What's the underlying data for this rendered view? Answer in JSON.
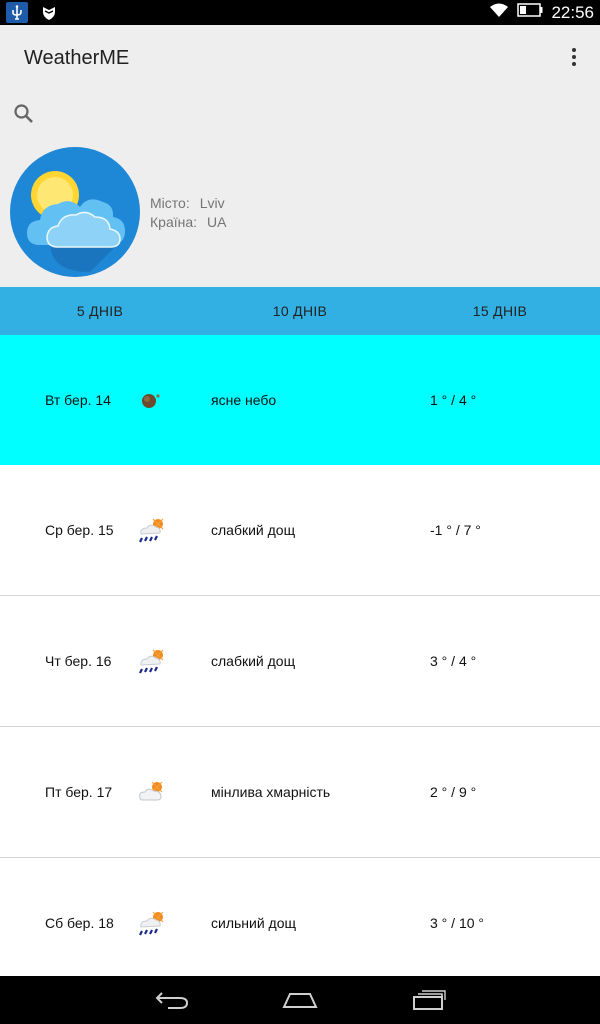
{
  "status_bar": {
    "time": "22:56",
    "icons": [
      "usb-icon",
      "shield-icon",
      "wifi-icon",
      "battery-icon"
    ]
  },
  "app": {
    "title": "WeatherME",
    "menu_icon": "overflow-menu-icon"
  },
  "search": {
    "icon": "search-icon"
  },
  "location": {
    "city_label": "Місто:",
    "city_value": "Lviv",
    "country_label": "Країна:",
    "country_value": "UA"
  },
  "tabs": [
    {
      "label": "5 ДНІВ"
    },
    {
      "label": "10 ДНІВ"
    },
    {
      "label": "15 ДНІВ"
    }
  ],
  "forecast": [
    {
      "date": "Вт бер. 14",
      "description": "ясне небо",
      "temp": "1 ° / 4 °",
      "icon": "clear-night-icon",
      "selected": true
    },
    {
      "date": "Ср бер. 15",
      "description": "слабкий дощ",
      "temp": "-1 ° / 7 °",
      "icon": "rain-sun-icon",
      "selected": false
    },
    {
      "date": "Чт бер. 16",
      "description": "слабкий дощ",
      "temp": "3 ° / 4 °",
      "icon": "rain-sun-icon",
      "selected": false
    },
    {
      "date": "Пт бер. 17",
      "description": "мінлива хмарність",
      "temp": "2 ° / 9 °",
      "icon": "partly-cloudy-icon",
      "selected": false
    },
    {
      "date": "Сб бер. 18",
      "description": "сильний дощ",
      "temp": "3 ° / 10 °",
      "icon": "rain-sun-icon",
      "selected": false
    }
  ],
  "nav_bar": {
    "buttons": [
      "back-icon",
      "home-icon",
      "recents-icon"
    ]
  },
  "colors": {
    "tab_bar": "#33b0e3",
    "selected_row": "#00ffff",
    "header_bg": "#eeeeee"
  }
}
